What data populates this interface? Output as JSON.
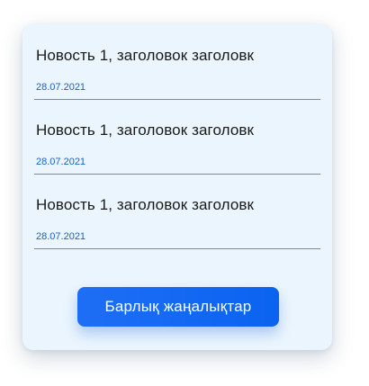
{
  "news": {
    "items": [
      {
        "title": "Новость 1, заголовок заголовк",
        "date": "28.07.2021"
      },
      {
        "title": "Новость 1, заголовок заголовк",
        "date": "28.07.2021"
      },
      {
        "title": "Новость 1, заголовок заголовк",
        "date": "28.07.2021"
      }
    ]
  },
  "all_news_button": {
    "label": "Барлық жаңалықтар"
  },
  "colors": {
    "card_background": "#eaf5fd",
    "date_text": "#1e5fc8",
    "button_background": "#1e6ef5"
  }
}
